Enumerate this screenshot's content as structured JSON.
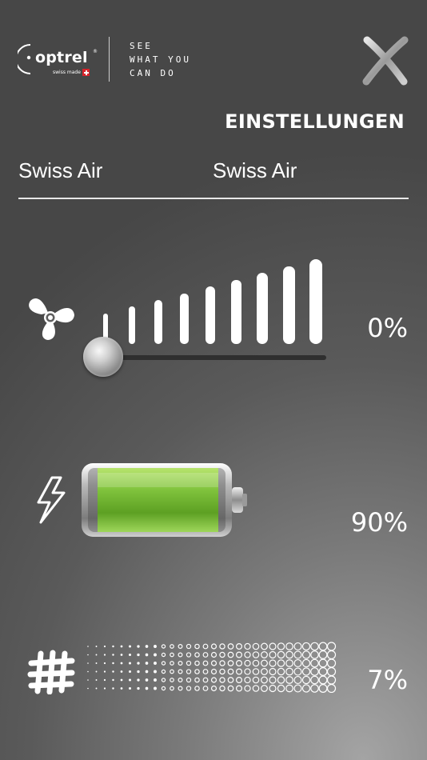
{
  "brand": {
    "name": "optrel",
    "registered": "®",
    "sub": "swiss made",
    "tagline": [
      "SEE",
      "WHAT YOU",
      "CAN DO"
    ]
  },
  "header": {
    "title": "EINSTELLUNGEN"
  },
  "profile": {
    "left_label": "Swiss Air",
    "right_label": "Swiss Air"
  },
  "fan": {
    "icon": "fan-icon",
    "level_percent": 0,
    "value_label": "0%",
    "bar_count": 9
  },
  "battery": {
    "icon": "lightning-icon",
    "level_percent": 90,
    "value_label": "90%"
  },
  "filter": {
    "icon": "filter-grid-icon",
    "level_percent": 7,
    "value_label": "7%"
  },
  "colors": {
    "battery_fill": "#7fc23c",
    "accent_red": "#d9242b",
    "text": "#ffffff"
  }
}
